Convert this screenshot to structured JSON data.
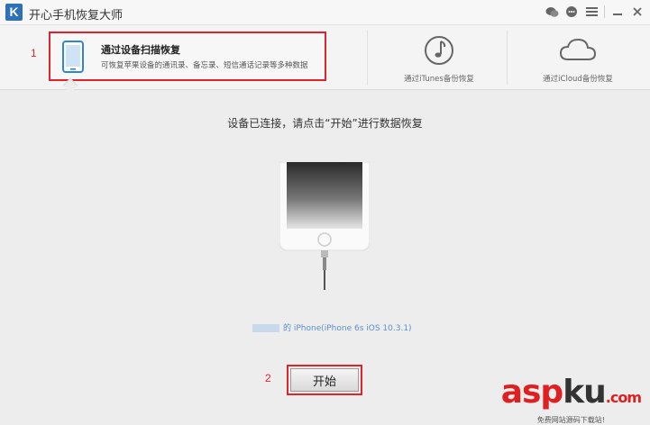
{
  "app": {
    "title": "开心手机恢复大师",
    "logo_letter": "K"
  },
  "tabs": {
    "active": {
      "title": "通过设备扫描恢复",
      "description": "可恢复苹果设备的通讯录、备忘录、短信通话记录等多种数据"
    },
    "itunes": {
      "label": "通过iTunes备份恢复"
    },
    "icloud": {
      "label": "通过iCloud备份恢复"
    }
  },
  "annotations": {
    "one": "1",
    "two": "2"
  },
  "main": {
    "status": "设备已连接，请点击“开始”进行数据恢复",
    "device_name": "的 iPhone(iPhone 6s iOS 10.3.1)",
    "start_label": "开始"
  },
  "watermark": {
    "part1": "asp",
    "part2": "ku",
    "suffix": ".com",
    "sub": "免费网站源码下载站!"
  },
  "colors": {
    "highlight": "#e0242b",
    "brand": "#2d72b8",
    "link": "#5a8fd0"
  }
}
